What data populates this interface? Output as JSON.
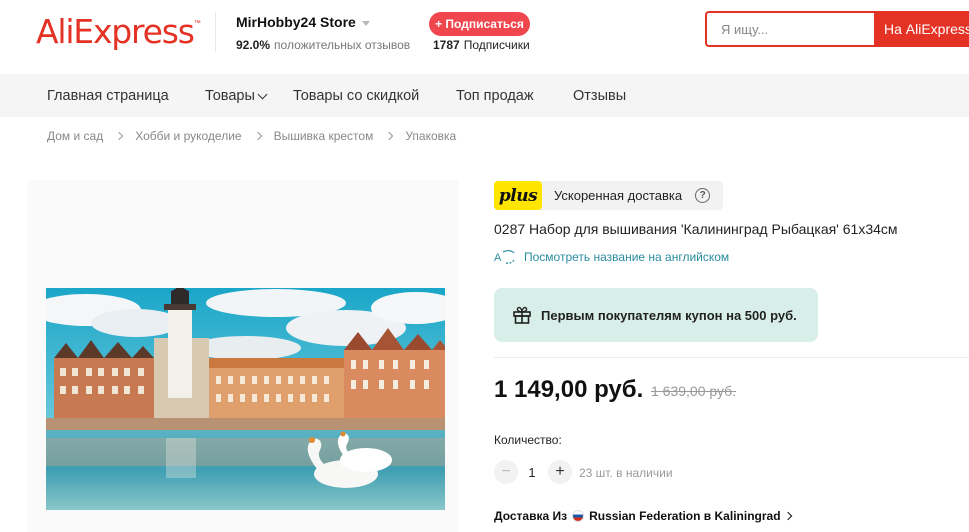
{
  "header": {
    "logo_text": "AliExpress",
    "logo_tm": "™",
    "store": {
      "name": "MirHobby24 Store",
      "rating": "92.0%",
      "rating_label": "положительных отзывов",
      "follow_label": "+ Подписаться",
      "followers_count": "1787",
      "followers_label": "Подписчики"
    },
    "search": {
      "placeholder": "Я ищу...",
      "button_label": "На AliExpress"
    }
  },
  "nav": {
    "items": [
      {
        "label": "Главная страница"
      },
      {
        "label": "Товары"
      },
      {
        "label": "Товары со скидкой"
      },
      {
        "label": "Топ продаж"
      },
      {
        "label": "Отзывы"
      }
    ]
  },
  "breadcrumb": [
    "Дом и сад",
    "Хобби и рукоделие",
    "Вышивка крестом",
    "Упаковка"
  ],
  "product": {
    "plus_badge": "plus",
    "plus_label": "Ускоренная доставка",
    "help_glyph": "?",
    "title": "0287 Набор для вышивания 'Калининград Рыбацкая' 61х34см",
    "translate_link": "Посмотреть название на английском",
    "coupon_text": "Первым покупателям купон на 500 руб.",
    "price": "1 149,00 руб.",
    "old_price": "1 639,00 руб.",
    "quantity_label": "Количество:",
    "quantity": "1",
    "minus_glyph": "−",
    "plus_glyph": "+",
    "stock": "23 шт. в наличии",
    "shipping": {
      "prefix": "Доставка Из",
      "from": "Russian Federation",
      "to_prefix": "в",
      "to": "Kaliningrad"
    }
  },
  "colors": {
    "brand": "#e43225",
    "follow_button": "#f0474e",
    "link": "#2a8ca0",
    "coupon_bg": "#d8efe9",
    "plus_yellow": "#ffe500"
  },
  "icons": [
    "chevron-down-icon",
    "chevron-right-icon",
    "help-icon",
    "translate-icon",
    "gift-icon",
    "russia-flag-icon"
  ]
}
